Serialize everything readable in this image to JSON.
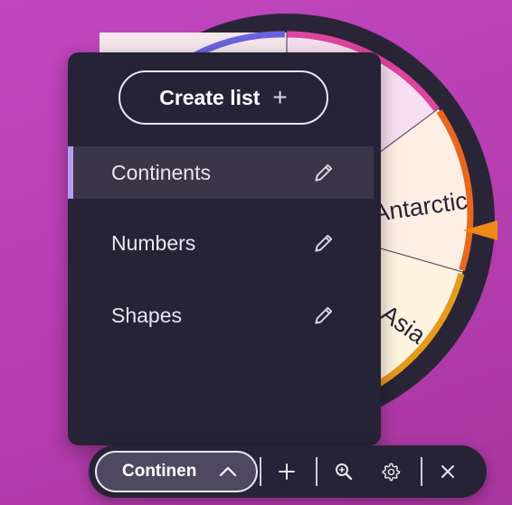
{
  "wheel": {
    "segments": [
      {
        "label": "Antarctic",
        "rim_color": "#e8671f",
        "fill": "#fdeee4"
      },
      {
        "label": "Asia",
        "rim_color": "#e59a1c",
        "fill": "#fdf3df"
      }
    ],
    "top_segment_rim_color": "#e0449e",
    "top_segment_fill": "#f6dff0",
    "pointer_color": "#ef8a18"
  },
  "lists_menu": {
    "create_label": "Create list",
    "create_icon": "plus-icon",
    "items": [
      {
        "label": "Continents",
        "selected": true,
        "icon": "pencil-icon"
      },
      {
        "label": "Numbers",
        "selected": false,
        "icon": "pencil-icon"
      },
      {
        "label": "Shapes",
        "selected": false,
        "icon": "pencil-icon"
      }
    ]
  },
  "toolbar": {
    "current_list": "Continen",
    "current_icon": "chevron-up-icon",
    "buttons": [
      "plus-icon",
      "zoom-in-icon",
      "gear-icon",
      "close-icon"
    ]
  },
  "colors": {
    "background": "#b83fb3",
    "panel": "#262336",
    "selected_row": "#3a3648",
    "selection_accent": "#b79cf0"
  }
}
